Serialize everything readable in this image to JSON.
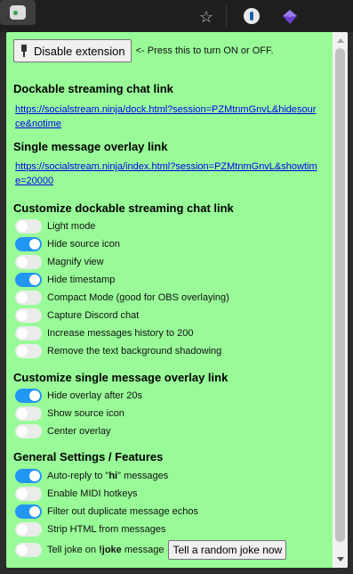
{
  "toolbar": {
    "icons": [
      "star-plus-icon",
      "password-manager-icon",
      "gem-extension-icon",
      "socialstream-extension-icon"
    ]
  },
  "header": {
    "disable_button": "Disable extension",
    "hint": "<- Press this to turn ON or OFF."
  },
  "dock": {
    "title": "Dockable streaming chat link",
    "link": "https://socialstream.ninja/dock.html?session=PZMtnmGnvL&hidesource&notime"
  },
  "overlay": {
    "title": "Single message overlay link",
    "link": "https://socialstream.ninja/index.html?session=PZMtnmGnvL&showtime=20000"
  },
  "dock_settings": {
    "title": "Customize dockable streaming chat link",
    "items": [
      {
        "label": "Light mode",
        "on": false
      },
      {
        "label": "Hide source icon",
        "on": true
      },
      {
        "label": "Magnify view",
        "on": false
      },
      {
        "label": "Hide timestamp",
        "on": true
      },
      {
        "label": "Compact Mode (good for OBS overlaying)",
        "on": false
      },
      {
        "label": "Capture Discord chat",
        "on": false
      },
      {
        "label": "Increase messages history to 200",
        "on": false
      },
      {
        "label": "Remove the text background shadowing",
        "on": false
      }
    ]
  },
  "overlay_settings": {
    "title": "Customize single message overlay link",
    "items": [
      {
        "label": "Hide overlay after 20s",
        "on": true
      },
      {
        "label": "Show source icon",
        "on": false
      },
      {
        "label": "Center overlay",
        "on": false
      }
    ]
  },
  "general": {
    "title": "General Settings / Features",
    "autoreply_pre": "Auto-reply to \"",
    "autoreply_bold": "hi",
    "autoreply_post": "\" messages",
    "autoreply_on": true,
    "midi": {
      "label": "Enable MIDI hotkeys",
      "on": false
    },
    "filter": {
      "label": "Filter out duplicate message echos",
      "on": true
    },
    "strip": {
      "label": "Strip HTML from messages",
      "on": false
    },
    "joke_pre": "Tell joke on ",
    "joke_bold": "!joke",
    "joke_post": " message",
    "joke_on": false,
    "joke_button": "Tell a random joke now"
  },
  "colors": {
    "popup_bg": "#98fb98",
    "toggle_on": "#2196f3",
    "toggle_off": "#e9ece9",
    "link": "#0000ee"
  }
}
